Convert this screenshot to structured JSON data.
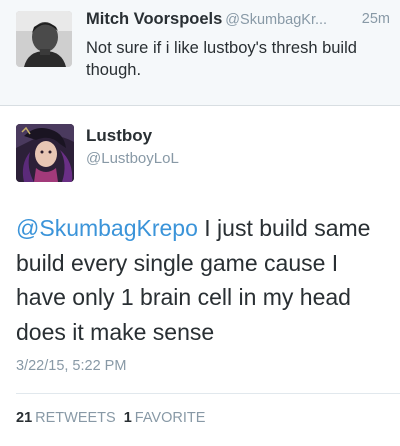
{
  "reply_tweet": {
    "name": "Mitch Voorspoels",
    "handle": "@SkumbagKr...",
    "time": "25m",
    "text": "Not sure if i like lustboy's thresh build though."
  },
  "tweet": {
    "name": "Lustboy",
    "handle": "@LustboyLoL",
    "mention": "@SkumbagKrepo",
    "text": " I just build same build every single game cause I have only 1 brain cell in my head does it make sense",
    "timestamp": "3/22/15, 5:22 PM",
    "retweets_count": "21",
    "retweets_label": "RETWEETS",
    "favorites_count": "1",
    "favorites_label": "FAVORITE"
  },
  "colors": {
    "link": "#3b94d9",
    "secondary_text": "#8899a6",
    "primary_text": "#292f33"
  }
}
